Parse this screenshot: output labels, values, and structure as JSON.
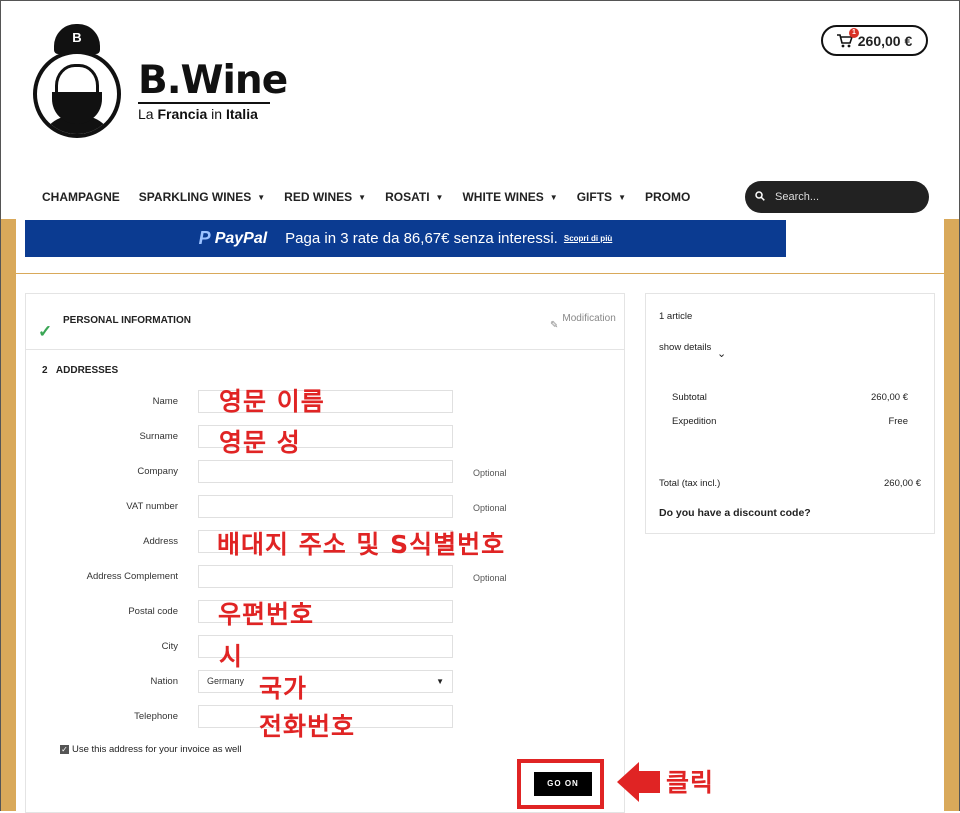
{
  "brand": {
    "title": "B.Wine",
    "cap_letter": "B",
    "sub_pre": "La ",
    "sub_bold": "Francia",
    "sub_mid": " in ",
    "sub_end": "Italia"
  },
  "cart": {
    "badge": "1",
    "total": "260,00 €"
  },
  "nav": [
    {
      "label": "CHAMPAGNE",
      "dropdown": false
    },
    {
      "label": "SPARKLING WINES",
      "dropdown": true
    },
    {
      "label": "RED WINES",
      "dropdown": true
    },
    {
      "label": "ROSATI",
      "dropdown": true
    },
    {
      "label": "WHITE WINES",
      "dropdown": true
    },
    {
      "label": "GIFTS",
      "dropdown": true
    },
    {
      "label": "PROMO",
      "dropdown": false
    }
  ],
  "search": {
    "placeholder": "Search..."
  },
  "paypal": {
    "logo": "PayPal",
    "text": "Paga in 3 rate da 86,67€ senza interessi.",
    "link": "Scopri di più"
  },
  "checkout": {
    "step1": {
      "title": "PERSONAL INFORMATION",
      "modify": "Modification"
    },
    "step2": {
      "number": "2",
      "title": "ADDRESSES"
    },
    "fields": [
      {
        "label": "Name",
        "value": "",
        "optional": ""
      },
      {
        "label": "Surname",
        "value": "",
        "optional": ""
      },
      {
        "label": "Company",
        "value": "",
        "optional": "Optional"
      },
      {
        "label": "VAT number",
        "value": "",
        "optional": "Optional"
      },
      {
        "label": "Address",
        "value": "",
        "optional": ""
      },
      {
        "label": "Address Complement",
        "value": "",
        "optional": "Optional"
      },
      {
        "label": "Postal code",
        "value": "",
        "optional": ""
      },
      {
        "label": "City",
        "value": "",
        "optional": ""
      },
      {
        "label": "Nation",
        "value": "Germany",
        "optional": ""
      },
      {
        "label": "Telephone",
        "value": "",
        "optional": ""
      }
    ],
    "invoice": "Use this address for your invoice as well",
    "go_on": "GO ON"
  },
  "annotations": {
    "name": "영문 이름",
    "surname": "영문 성",
    "address": "배대지 주소 및 S식별번호",
    "postal": "우편번호",
    "city": "시",
    "nation": "국가",
    "phone": "전화번호",
    "click": "클릭"
  },
  "summary": {
    "articles": "1 article",
    "show_details": "show details",
    "subtotal_label": "Subtotal",
    "subtotal_value": "260,00 €",
    "expedition_label": "Expedition",
    "expedition_value": "Free",
    "total_label": "Total (tax incl.)",
    "total_value": "260,00 €",
    "discount": "Do you have a discount code?"
  },
  "colors": {
    "gold": "#d9a95a",
    "paypal_blue": "#0b3b91",
    "annotation_red": "#e02424",
    "check_green": "#3aa655"
  }
}
